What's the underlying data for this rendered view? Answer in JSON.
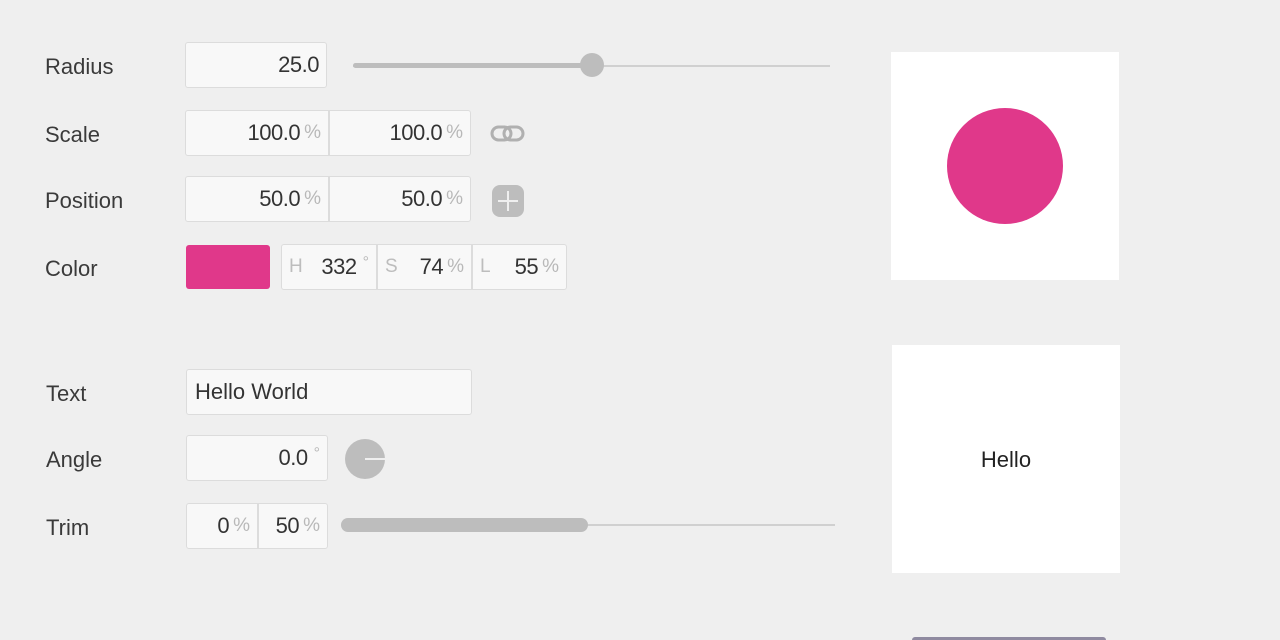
{
  "shape": {
    "radius": {
      "label": "Radius",
      "value": "25.0",
      "slider_fraction": 0.5
    },
    "scale": {
      "label": "Scale",
      "x": "100.0",
      "y": "100.0",
      "unit": "%"
    },
    "position": {
      "label": "Position",
      "x": "50.0",
      "y": "50.0",
      "unit": "%"
    },
    "color": {
      "label": "Color",
      "swatch": "#e0388a",
      "h_prefix": "H",
      "h": "332",
      "h_unit": "°",
      "s_prefix": "S",
      "s": "74",
      "s_unit": "%",
      "l_prefix": "L",
      "l": "55",
      "l_unit": "%"
    }
  },
  "text": {
    "text": {
      "label": "Text",
      "value": "Hello World"
    },
    "angle": {
      "label": "Angle",
      "value": "0.0",
      "unit": "°"
    },
    "trim": {
      "label": "Trim",
      "start": "0",
      "end": "50",
      "unit": "%",
      "start_fraction": 0.0,
      "end_fraction": 0.5
    }
  },
  "previews": {
    "circle_color": "#e0388a",
    "text_preview": "Hello"
  },
  "icons": {
    "link": "link-icon",
    "add": "plus-icon",
    "angle": "angle-dial-icon"
  },
  "colors": {
    "background": "#efefef",
    "control_gray": "#bdbdbd",
    "accent": "#e0388a"
  }
}
